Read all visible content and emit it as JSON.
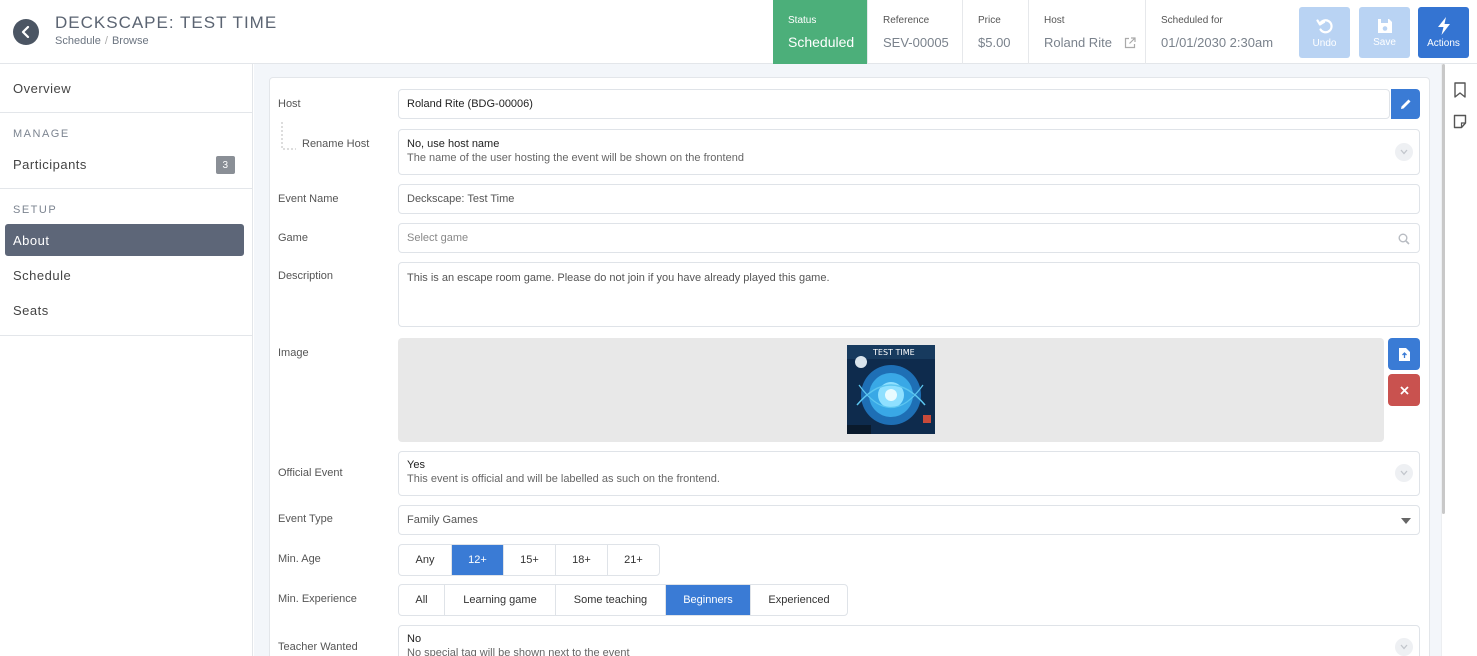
{
  "header": {
    "title": "DECKSCAPE: TEST TIME",
    "breadcrumb": [
      "Schedule",
      "Browse"
    ],
    "status": {
      "label": "Status",
      "value": "Scheduled"
    },
    "reference": {
      "label": "Reference",
      "value": "SEV-00005"
    },
    "price": {
      "label": "Price",
      "value": "$5.00"
    },
    "host": {
      "label": "Host",
      "value": "Roland Rite"
    },
    "scheduled": {
      "label": "Scheduled for",
      "value": "01/01/2030 2:30am"
    },
    "buttons": {
      "undo": "Undo",
      "save": "Save",
      "actions": "Actions"
    }
  },
  "sidebar": {
    "overview": "Overview",
    "manage_heading": "MANAGE",
    "participants": "Participants",
    "participants_count": "3",
    "setup_heading": "SETUP",
    "about": "About",
    "schedule": "Schedule",
    "seats": "Seats"
  },
  "form": {
    "host": {
      "label": "Host",
      "value": "Roland Rite (BDG-00006)"
    },
    "rename_host": {
      "label": "Rename Host",
      "value": "No, use host name",
      "hint": "The name of the user hosting the event will be shown on the frontend"
    },
    "event_name": {
      "label": "Event Name",
      "value": "Deckscape: Test Time"
    },
    "game": {
      "label": "Game",
      "placeholder": "Select game"
    },
    "description": {
      "label": "Description",
      "value": "This is an escape room game.  Please do not join if you have already played this game."
    },
    "image": {
      "label": "Image",
      "thumb_title": "TEST TIME"
    },
    "official_event": {
      "label": "Official Event",
      "value": "Yes",
      "hint": "This event is official and will be labelled as such on the frontend."
    },
    "event_type": {
      "label": "Event Type",
      "value": "Family Games"
    },
    "min_age": {
      "label": "Min. Age",
      "options": [
        "Any",
        "12+",
        "15+",
        "18+",
        "21+"
      ],
      "selected": "12+"
    },
    "min_experience": {
      "label": "Min. Experience",
      "options": [
        "All",
        "Learning game",
        "Some teaching",
        "Beginners",
        "Experienced"
      ],
      "selected": "Beginners"
    },
    "teacher_wanted": {
      "label": "Teacher Wanted",
      "value": "No",
      "hint": "No special tag will be shown next to the event"
    }
  },
  "colors": {
    "status_green": "#4caf7a",
    "primary_blue": "#3474d2",
    "selected_blue": "#3a7bd5",
    "danger_red": "#c9524f",
    "sidebar_active": "#5d6678"
  }
}
